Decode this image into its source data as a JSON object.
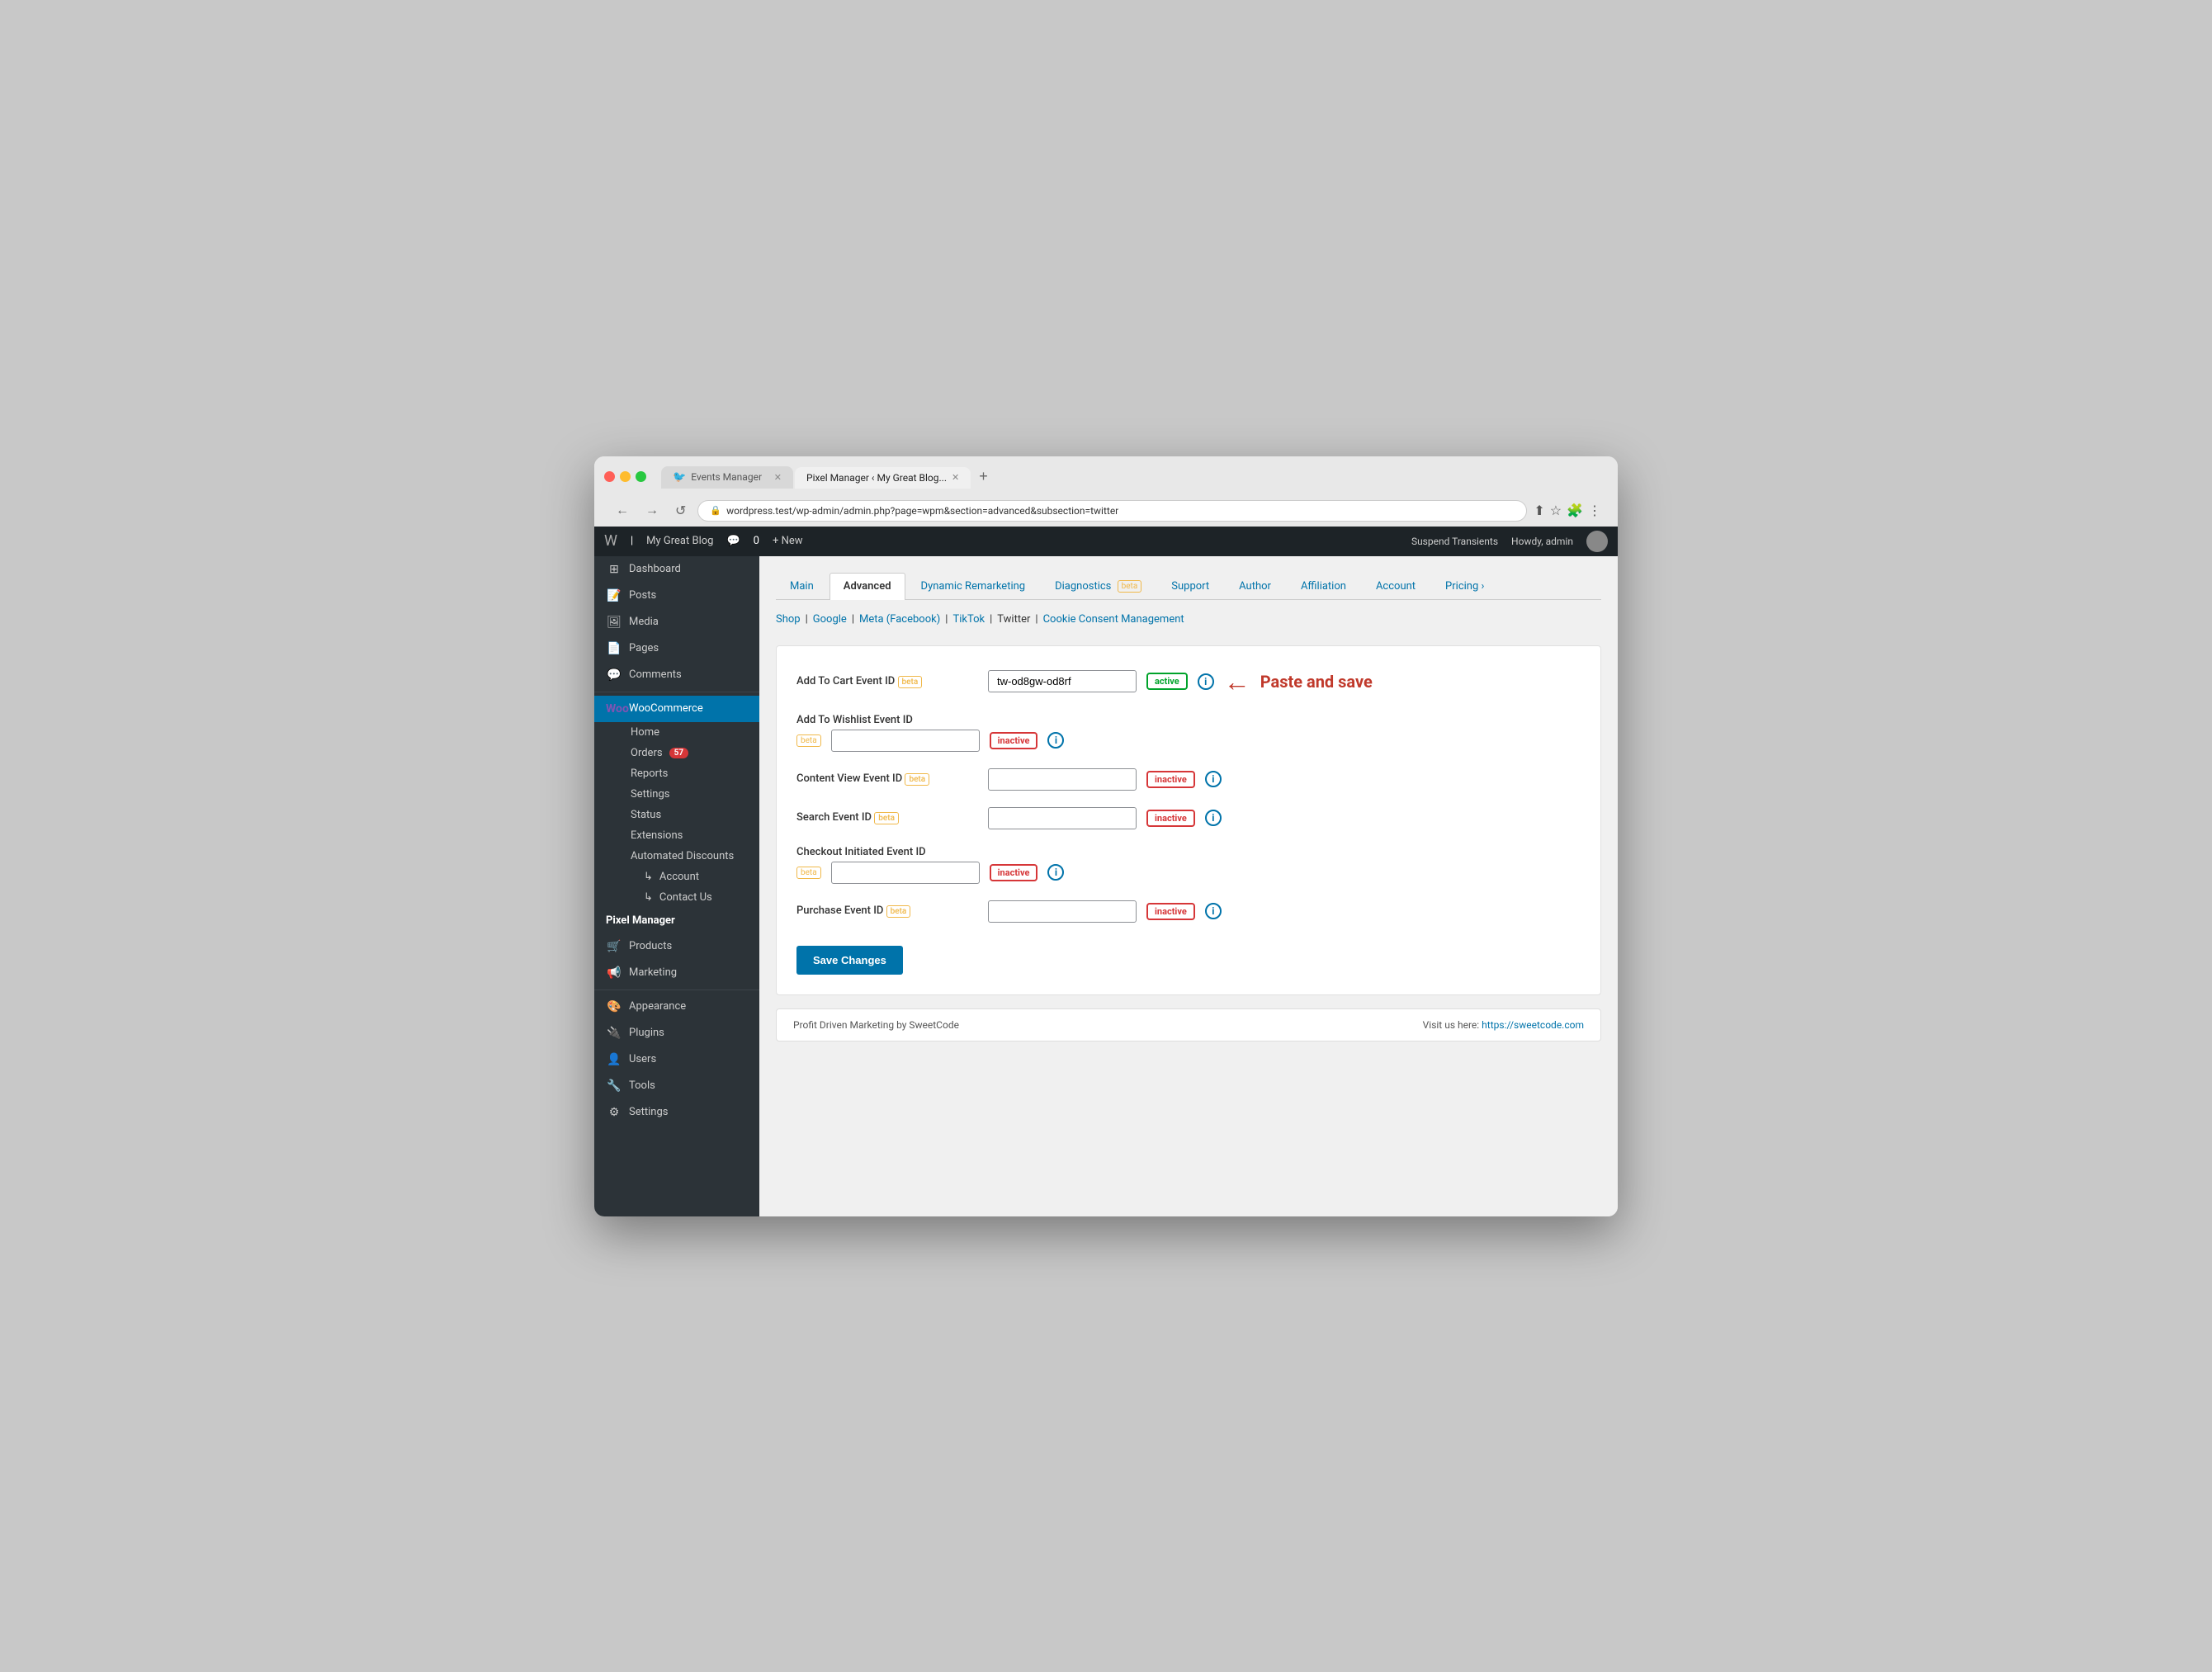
{
  "browser": {
    "tabs": [
      {
        "id": "tab1",
        "label": "Events Manager",
        "icon": "🐦",
        "active": false
      },
      {
        "id": "tab2",
        "label": "Pixel Manager ‹ My Great Blog...",
        "icon": "",
        "active": true
      }
    ],
    "address": "wordpress.test/wp-admin/admin.php?page=wpm&section=advanced&subsection=twitter",
    "add_tab": "+",
    "nav_back": "←",
    "nav_forward": "→",
    "nav_refresh": "↺"
  },
  "wp_admin_bar": {
    "logo": "W",
    "site_name": "My Great Blog",
    "comments_icon": "💬",
    "comments_count": "0",
    "new_label": "+ New",
    "suspend_transients": "Suspend Transients",
    "howdy": "Howdy, admin"
  },
  "sidebar": {
    "dashboard": {
      "label": "Dashboard",
      "icon": "⊞"
    },
    "posts": {
      "label": "Posts",
      "icon": "📝"
    },
    "media": {
      "label": "Media",
      "icon": "🖼"
    },
    "pages": {
      "label": "Pages",
      "icon": "📄"
    },
    "comments": {
      "label": "Comments",
      "icon": "💬"
    },
    "woocommerce": {
      "label": "WooCommerce",
      "icon": "Woo",
      "active": true
    },
    "woo_sub": {
      "home": "Home",
      "orders": "Orders",
      "orders_badge": "57",
      "reports": "Reports",
      "settings": "Settings",
      "status": "Status",
      "extensions": "Extensions",
      "automated_discounts": "Automated Discounts",
      "account": "Account",
      "contact_us": "Contact Us"
    },
    "pixel_manager": {
      "label": "Pixel Manager",
      "bold": true
    },
    "products": {
      "label": "Products",
      "icon": "🛒"
    },
    "marketing": {
      "label": "Marketing",
      "icon": "📢"
    },
    "appearance": {
      "label": "Appearance",
      "icon": "🎨"
    },
    "plugins": {
      "label": "Plugins",
      "icon": "🔌"
    },
    "users": {
      "label": "Users",
      "icon": "👤"
    },
    "tools": {
      "label": "Tools",
      "icon": "🔧"
    },
    "settings": {
      "label": "Settings",
      "icon": "⚙"
    }
  },
  "plugin_tabs": [
    {
      "id": "main",
      "label": "Main",
      "active": false,
      "beta": false
    },
    {
      "id": "advanced",
      "label": "Advanced",
      "active": true,
      "beta": false
    },
    {
      "id": "dynamic_remarketing",
      "label": "Dynamic Remarketing",
      "active": false,
      "beta": false
    },
    {
      "id": "diagnostics",
      "label": "Diagnostics",
      "active": false,
      "beta": true
    },
    {
      "id": "support",
      "label": "Support",
      "active": false,
      "beta": false
    },
    {
      "id": "author",
      "label": "Author",
      "active": false,
      "beta": false
    },
    {
      "id": "affiliation",
      "label": "Affiliation",
      "active": false,
      "beta": false
    },
    {
      "id": "account",
      "label": "Account",
      "active": false,
      "beta": false
    },
    {
      "id": "pricing",
      "label": "Pricing ›",
      "active": false,
      "beta": false
    }
  ],
  "sub_nav": {
    "items": [
      {
        "id": "shop",
        "label": "Shop",
        "current": false
      },
      {
        "id": "google",
        "label": "Google",
        "current": false
      },
      {
        "id": "meta",
        "label": "Meta (Facebook)",
        "current": false
      },
      {
        "id": "tiktok",
        "label": "TikTok",
        "current": false
      },
      {
        "id": "twitter",
        "label": "Twitter",
        "current": true
      },
      {
        "id": "cookie",
        "label": "Cookie Consent Management",
        "current": false
      }
    ]
  },
  "fields": [
    {
      "id": "add_to_cart",
      "label": "Add To Cart Event ID",
      "beta": true,
      "value": "tw-od8gw-od8rf",
      "status": "active",
      "has_annotation": true
    },
    {
      "id": "add_to_wishlist",
      "label": "Add To Wishlist Event ID",
      "beta": true,
      "value": "",
      "status": "inactive",
      "has_annotation": false
    },
    {
      "id": "content_view",
      "label": "Content View Event ID",
      "beta": true,
      "value": "",
      "status": "inactive",
      "has_annotation": false
    },
    {
      "id": "search",
      "label": "Search Event ID",
      "beta": true,
      "value": "",
      "status": "inactive",
      "has_annotation": false
    },
    {
      "id": "checkout_initiated",
      "label": "Checkout Initiated Event ID",
      "beta": true,
      "value": "",
      "status": "inactive",
      "has_annotation": false
    },
    {
      "id": "purchase",
      "label": "Purchase Event ID",
      "beta": true,
      "value": "",
      "status": "inactive",
      "has_annotation": false
    }
  ],
  "annotation": {
    "arrow": "←",
    "text": "Paste and save"
  },
  "save_button": "Save Changes",
  "footer": {
    "left": "Profit Driven Marketing by SweetCode",
    "right_prefix": "Visit us here: ",
    "right_link": "https://sweetcode.com"
  }
}
